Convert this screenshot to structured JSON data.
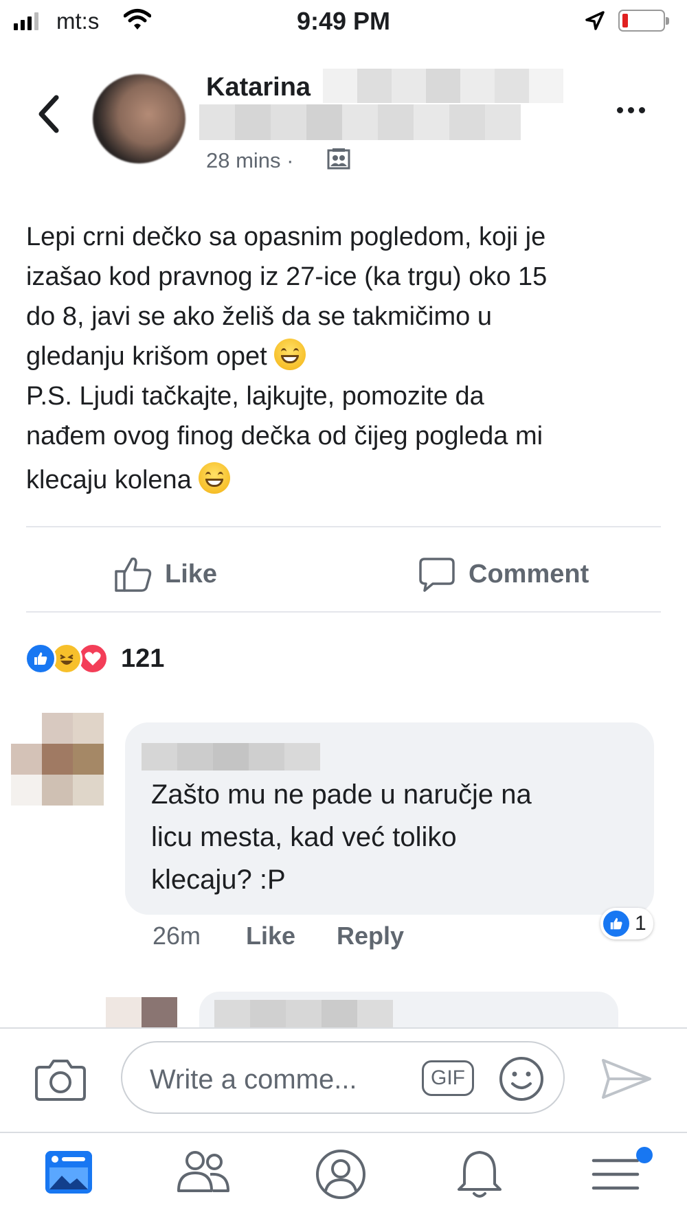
{
  "status_bar": {
    "carrier": "mt:s",
    "time": "9:49 PM"
  },
  "post": {
    "author_name": "Katarina",
    "timestamp": "28 mins ·",
    "body_lines": [
      "Lepi crni dečko sa opasnim pogledom, koji je",
      "izašao kod pravnog iz 27-ice (ka trgu) oko 15",
      "do 8, javi se ako želiš da se takmičimo u",
      "gledanju krišom opet",
      "P.S. Ljudi tačkajte, lajkujte, pomozite da",
      "nađem ovog finog dečka od čijeg pogleda mi",
      "klecaju kolena"
    ],
    "like_label": "Like",
    "comment_label": "Comment",
    "reaction_count": "121",
    "reaction_icons": [
      "like-icon",
      "haha-icon",
      "love-icon"
    ]
  },
  "comment": {
    "text_lines": [
      "Zašto mu ne pade u naručje na",
      "licu mesta, kad već toliko",
      "klecaju? :P"
    ],
    "time": "26m",
    "like_label": "Like",
    "reply_label": "Reply",
    "like_count": "1"
  },
  "composer": {
    "placeholder": "Write a comme...",
    "gif_label": "GIF"
  },
  "tab_bar": {
    "tabs": [
      "news-feed-icon",
      "friends-icon",
      "profile-icon",
      "notifications-icon",
      "menu-icon"
    ],
    "active_tab": "news-feed-icon"
  },
  "colors": {
    "brand_blue": "#1877f2",
    "text": "#1c1e21",
    "secondary_text": "#606770",
    "bubble": "#f0f2f5",
    "love_red": "#f33e58",
    "haha_yellow": "#f7c02b"
  }
}
